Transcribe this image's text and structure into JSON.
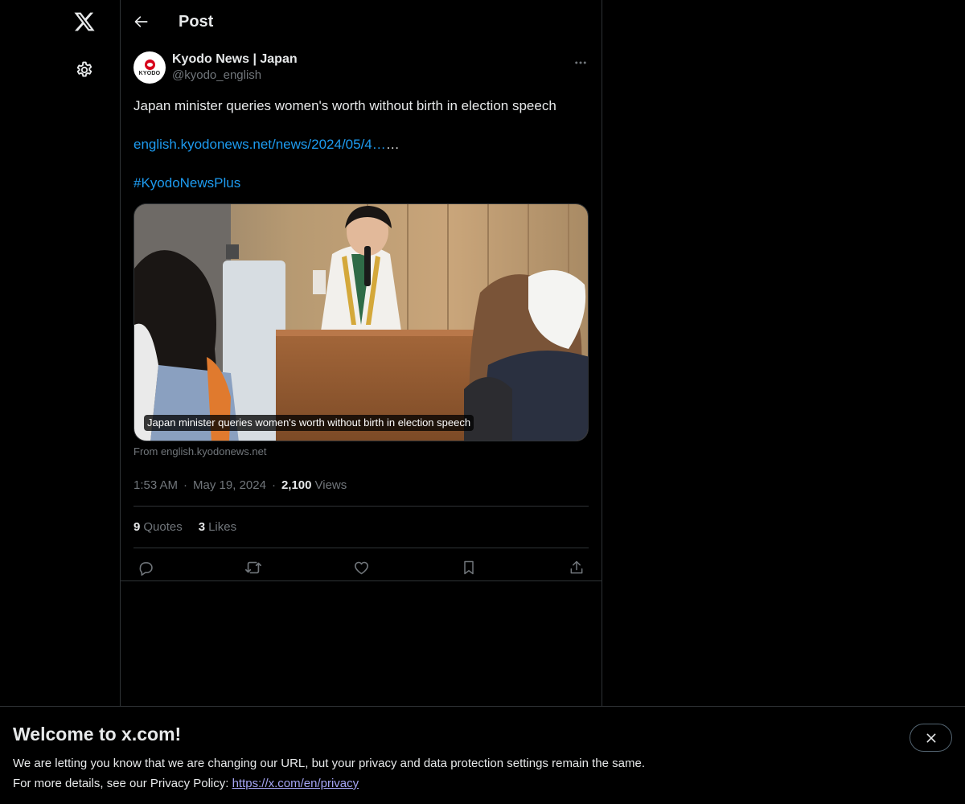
{
  "header": {
    "title": "Post"
  },
  "post": {
    "author_name": "Kyodo News | Japan",
    "author_handle": "@kyodo_english",
    "avatar_text": "KYODO",
    "text": "Japan minister queries women's worth without birth in election speech",
    "link_text": "english.kyodonews.net/news/2024/05/4…",
    "link_suffix": "…",
    "hashtag": "#KyodoNewsPlus",
    "media_caption": "Japan minister queries women's worth without birth in election speech",
    "from_source": "From english.kyodonews.net",
    "time": "1:53 AM",
    "date": "May 19, 2024",
    "views_count": "2,100",
    "views_label": "Views",
    "quotes_count": "9",
    "quotes_label": "Quotes",
    "likes_count": "3",
    "likes_label": "Likes"
  },
  "banner": {
    "title": "Welcome to x.com!",
    "line1": "We are letting you know that we are changing our URL, but your privacy and data protection settings remain the same.",
    "line2_prefix": "For more details, see our Privacy Policy: ",
    "privacy_link": "https://x.com/en/privacy"
  },
  "icons": {
    "logo": "x-logo-icon",
    "settings": "gear-icon",
    "back": "arrow-left-icon",
    "more": "more-horizontal-icon",
    "reply": "reply-icon",
    "repost": "repost-icon",
    "like": "heart-icon",
    "bookmark": "bookmark-icon",
    "share": "share-icon",
    "close": "close-icon"
  },
  "colors": {
    "background": "#000000",
    "text": "#e7e9ea",
    "secondary": "#71767b",
    "link": "#1d9bf0",
    "border": "#2f3336"
  }
}
